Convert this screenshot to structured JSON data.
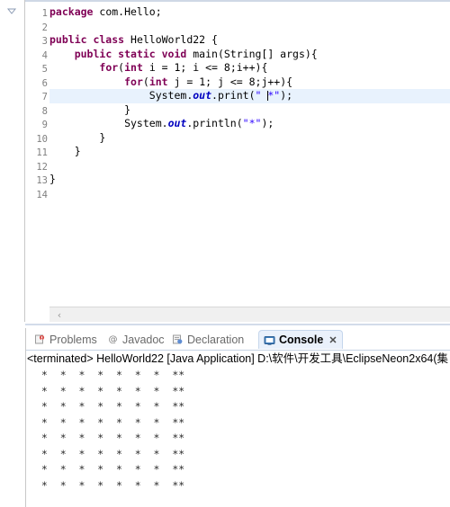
{
  "editor": {
    "language": "java",
    "caret_line": 7,
    "changed_lines": [
      4,
      11
    ],
    "fold_marker_line": 4,
    "line_numbers": [
      "1",
      "2",
      "3",
      "4",
      "5",
      "6",
      "7",
      "8",
      "9",
      "10",
      "11",
      "12",
      "13",
      "14"
    ],
    "lines": [
      {
        "n": 1,
        "tokens": [
          {
            "t": "kw",
            "v": "package"
          },
          {
            "t": "plain",
            "v": " com.Hello;"
          }
        ]
      },
      {
        "n": 2,
        "tokens": []
      },
      {
        "n": 3,
        "tokens": [
          {
            "t": "kw",
            "v": "public class"
          },
          {
            "t": "plain",
            "v": " HelloWorld22 {"
          }
        ]
      },
      {
        "n": 4,
        "tokens": [
          {
            "t": "plain",
            "v": "    "
          },
          {
            "t": "kw",
            "v": "public static void"
          },
          {
            "t": "plain",
            "v": " main(String[] args){"
          }
        ]
      },
      {
        "n": 5,
        "tokens": [
          {
            "t": "plain",
            "v": "        "
          },
          {
            "t": "kw",
            "v": "for"
          },
          {
            "t": "plain",
            "v": "("
          },
          {
            "t": "kw",
            "v": "int"
          },
          {
            "t": "plain",
            "v": " i = 1; i <= 8;i++){"
          }
        ]
      },
      {
        "n": 6,
        "tokens": [
          {
            "t": "plain",
            "v": "            "
          },
          {
            "t": "kw",
            "v": "for"
          },
          {
            "t": "plain",
            "v": "("
          },
          {
            "t": "kw",
            "v": "int"
          },
          {
            "t": "plain",
            "v": " j = 1; j <= 8;j++){"
          }
        ]
      },
      {
        "n": 7,
        "tokens": [
          {
            "t": "plain",
            "v": "                System."
          },
          {
            "t": "fld",
            "v": "out"
          },
          {
            "t": "plain",
            "v": ".print("
          },
          {
            "t": "str",
            "v": "\" "
          },
          {
            "t": "caret",
            "v": ""
          },
          {
            "t": "str",
            "v": "*\""
          },
          {
            "t": "plain",
            "v": ");"
          }
        ]
      },
      {
        "n": 8,
        "tokens": [
          {
            "t": "plain",
            "v": "            }"
          }
        ]
      },
      {
        "n": 9,
        "tokens": [
          {
            "t": "plain",
            "v": "            System."
          },
          {
            "t": "fld",
            "v": "out"
          },
          {
            "t": "plain",
            "v": ".println("
          },
          {
            "t": "str",
            "v": "\"*\""
          },
          {
            "t": "plain",
            "v": ");"
          }
        ]
      },
      {
        "n": 10,
        "tokens": [
          {
            "t": "plain",
            "v": "        }"
          }
        ]
      },
      {
        "n": 11,
        "tokens": [
          {
            "t": "plain",
            "v": "    }"
          }
        ]
      },
      {
        "n": 12,
        "tokens": []
      },
      {
        "n": 13,
        "tokens": [
          {
            "t": "plain",
            "v": "}"
          }
        ]
      },
      {
        "n": 14,
        "tokens": []
      }
    ],
    "scroll_left_arrow": "‹"
  },
  "console": {
    "tabs": [
      {
        "label": "Problems",
        "icon": "problems-icon",
        "active": false
      },
      {
        "label": "Javadoc",
        "icon": "javadoc-icon",
        "active": false
      },
      {
        "label": "Declaration",
        "icon": "declaration-icon",
        "active": false
      },
      {
        "label": "Console",
        "icon": "console-icon",
        "active": true
      }
    ],
    "close_glyph": "✕",
    "terminated_line": "<terminated> HelloWorld22 [Java Application] D:\\软件\\开发工具\\EclipseNeon2x64(集",
    "output_rows": [
      " *  *  *  *  *  *  *  **",
      " *  *  *  *  *  *  *  **",
      " *  *  *  *  *  *  *  **",
      " *  *  *  *  *  *  *  **",
      " *  *  *  *  *  *  *  **",
      " *  *  *  *  *  *  *  **",
      " *  *  *  *  *  *  *  **",
      " *  *  *  *  *  *  *  **"
    ]
  },
  "colors": {
    "keyword": "#7f0055",
    "string": "#2a00ff",
    "field": "#0000c0",
    "current_line": "#e8f2fd",
    "change_bar": "#7eb4e8",
    "active_tab_bg": "#eaf1fb"
  }
}
